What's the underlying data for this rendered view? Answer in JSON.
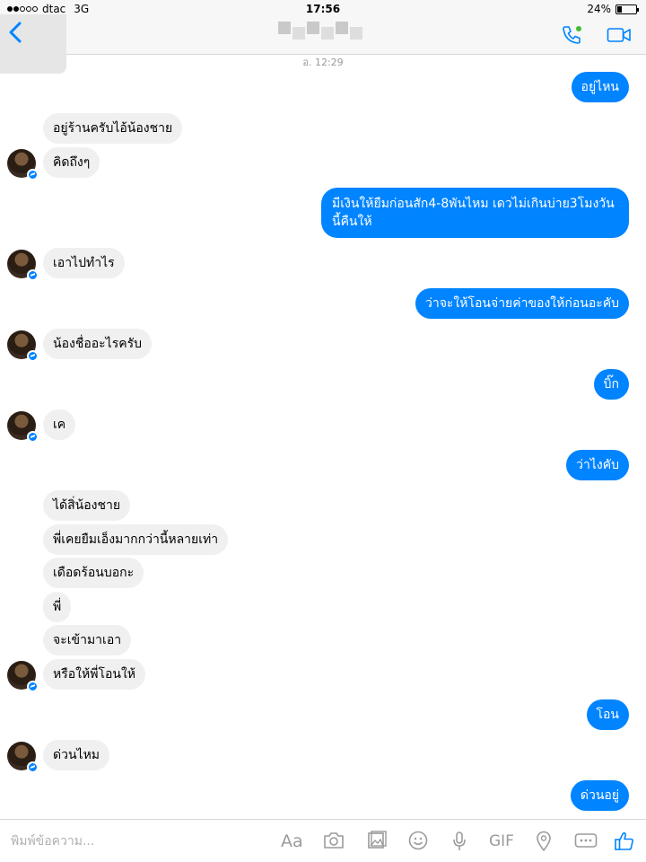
{
  "status": {
    "carrier": "dtac",
    "network": "3G",
    "time": "17:56",
    "battery": "24%",
    "battery_level": 0.24
  },
  "nav": {
    "back_icon": "chevron-left-icon",
    "call_icon": "phone-icon",
    "video_icon": "video-camera-icon"
  },
  "conversation": {
    "timestamp": "อ. 12:29",
    "messages": [
      {
        "dir": "out",
        "text": "อยู่ไหน"
      },
      {
        "dir": "in",
        "text": "อยู่ร้านครับไอ้น้องชาย"
      },
      {
        "dir": "in",
        "text": "คิดถึงๆ"
      },
      {
        "dir": "out",
        "text": "มีเงินให้ยืมก่อนสัก4-8พันไหม เดวไม่เกินบ่าย3โมงวันนี้คืนให้"
      },
      {
        "dir": "in",
        "text": "เอาไปทำไร"
      },
      {
        "dir": "out",
        "text": "ว่าจะให้โอนจ่ายค่าของให้ก่อนอะคับ"
      },
      {
        "dir": "in",
        "text": "น้องชื่ออะไรครับ"
      },
      {
        "dir": "out",
        "text": "บิ๊ก"
      },
      {
        "dir": "in",
        "text": "เค"
      },
      {
        "dir": "out",
        "text": "ว่าไงคับ"
      },
      {
        "dir": "in",
        "text": "ได้สิ่น้องชาย"
      },
      {
        "dir": "in",
        "text": "พี่เคยยืมเอ็งมากกว่านี้หลายเท่า"
      },
      {
        "dir": "in",
        "text": "เดือดร้อนบอกะ"
      },
      {
        "dir": "in",
        "text": "พี่"
      },
      {
        "dir": "in",
        "text": "จะเข้ามาเอา"
      },
      {
        "dir": "in",
        "text": "หรือให้พี่โอนให้"
      },
      {
        "dir": "out",
        "text": "โอน"
      },
      {
        "dir": "in",
        "text": "ด่วนไหม"
      },
      {
        "dir": "out",
        "text": "ด่วนอยู่"
      }
    ]
  },
  "composer": {
    "placeholder": "พิมพ์ข้อความ...",
    "aa_label": "Aa",
    "gif_label": "GIF",
    "camera_icon": "camera-icon",
    "gallery_icon": "photo-gallery-icon",
    "emoji_icon": "emoji-icon",
    "mic_icon": "microphone-icon",
    "location_icon": "location-pin-icon",
    "more_icon": "more-icon",
    "like_icon": "thumbs-up-icon"
  },
  "colors": {
    "outgoing": "#0084ff",
    "incoming": "#f1f0f0",
    "accent": "#0084ff",
    "online": "#44bb33"
  }
}
